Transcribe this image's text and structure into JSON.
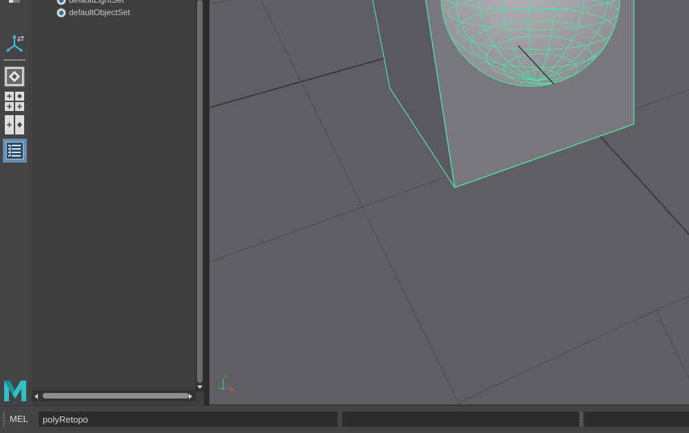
{
  "outliner": {
    "items": [
      {
        "label": "defaultLightSet"
      },
      {
        "label": "defaultObjectSet"
      }
    ]
  },
  "command_line": {
    "language_label": "MEL",
    "input_value": "polyRetopo"
  },
  "colors": {
    "selection_wireframe": "#4fe3a8",
    "viewport_background": "#5f5e62",
    "maya_logo": "#2fc0c8"
  },
  "icons": {
    "toolbox": [
      "transform-tool-icon",
      "render-view-icon",
      "four-view-layout-icon",
      "two-view-layout-icon",
      "outliner-layout-icon"
    ],
    "logo": "maya-logo-icon"
  }
}
